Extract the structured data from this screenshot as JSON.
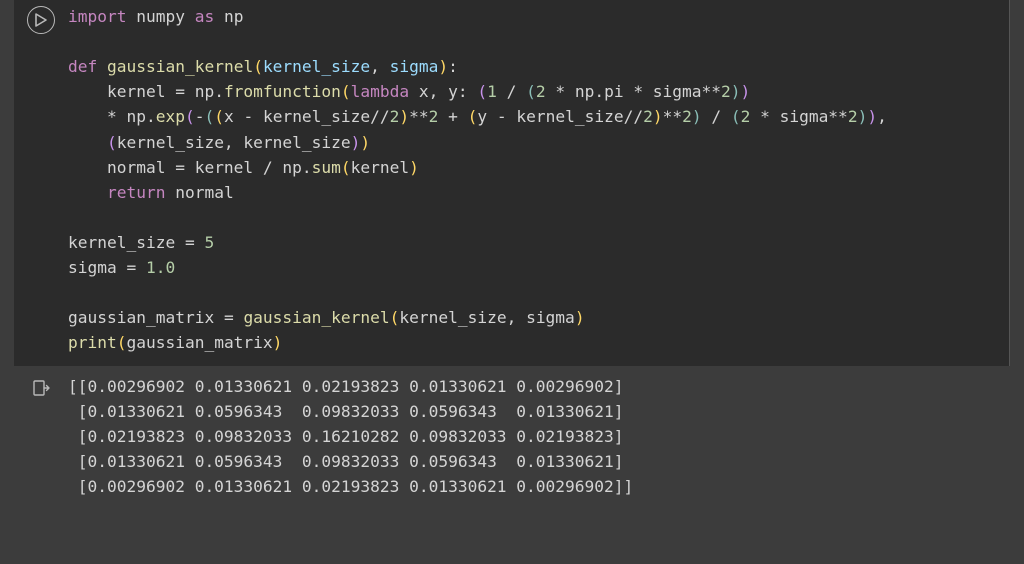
{
  "code": {
    "lines": [
      {
        "tokens": [
          {
            "t": "import",
            "c": "tk-kw"
          },
          {
            "t": " ",
            "c": ""
          },
          {
            "t": "numpy",
            "c": "tk-var"
          },
          {
            "t": " ",
            "c": ""
          },
          {
            "t": "as",
            "c": "tk-kw"
          },
          {
            "t": " ",
            "c": ""
          },
          {
            "t": "np",
            "c": "tk-var"
          }
        ]
      },
      {
        "tokens": []
      },
      {
        "tokens": [
          {
            "t": "def",
            "c": "tk-kw"
          },
          {
            "t": " ",
            "c": ""
          },
          {
            "t": "gaussian_kernel",
            "c": "tk-func"
          },
          {
            "t": "(",
            "c": "tk-paren"
          },
          {
            "t": "kernel_size",
            "c": "tk-param"
          },
          {
            "t": ", ",
            "c": ""
          },
          {
            "t": "sigma",
            "c": "tk-param"
          },
          {
            "t": ")",
            "c": "tk-paren"
          },
          {
            "t": ":",
            "c": ""
          }
        ]
      },
      {
        "tokens": [
          {
            "t": "    kernel ",
            "c": ""
          },
          {
            "t": "=",
            "c": "tk-op"
          },
          {
            "t": " np.",
            "c": ""
          },
          {
            "t": "fromfunction",
            "c": "tk-call"
          },
          {
            "t": "(",
            "c": "tk-paren"
          },
          {
            "t": "lambda",
            "c": "tk-kw"
          },
          {
            "t": " x, y: ",
            "c": ""
          },
          {
            "t": "(",
            "c": "tk-paren2"
          },
          {
            "t": "1",
            "c": "tk-num"
          },
          {
            "t": " / ",
            "c": ""
          },
          {
            "t": "(",
            "c": "tk-paren3"
          },
          {
            "t": "2",
            "c": "tk-num"
          },
          {
            "t": " * np.pi * sigma**",
            "c": ""
          },
          {
            "t": "2",
            "c": "tk-num"
          },
          {
            "t": ")",
            "c": "tk-paren3"
          },
          {
            "t": ")",
            "c": "tk-paren2"
          }
        ]
      },
      {
        "tokens": [
          {
            "t": "    * np.",
            "c": ""
          },
          {
            "t": "exp",
            "c": "tk-call"
          },
          {
            "t": "(",
            "c": "tk-paren2"
          },
          {
            "t": "-",
            "c": ""
          },
          {
            "t": "(",
            "c": "tk-paren3"
          },
          {
            "t": "(",
            "c": "tk-paren"
          },
          {
            "t": "x - kernel_size//",
            "c": ""
          },
          {
            "t": "2",
            "c": "tk-num"
          },
          {
            "t": ")",
            "c": "tk-paren"
          },
          {
            "t": "**",
            "c": ""
          },
          {
            "t": "2",
            "c": "tk-num"
          },
          {
            "t": " + ",
            "c": ""
          },
          {
            "t": "(",
            "c": "tk-paren"
          },
          {
            "t": "y - kernel_size//",
            "c": ""
          },
          {
            "t": "2",
            "c": "tk-num"
          },
          {
            "t": ")",
            "c": "tk-paren"
          },
          {
            "t": "**",
            "c": ""
          },
          {
            "t": "2",
            "c": "tk-num"
          },
          {
            "t": ")",
            "c": "tk-paren3"
          },
          {
            "t": " / ",
            "c": ""
          },
          {
            "t": "(",
            "c": "tk-paren3"
          },
          {
            "t": "2",
            "c": "tk-num"
          },
          {
            "t": " * sigma**",
            "c": ""
          },
          {
            "t": "2",
            "c": "tk-num"
          },
          {
            "t": ")",
            "c": "tk-paren3"
          },
          {
            "t": ")",
            "c": "tk-paren2"
          },
          {
            "t": ",",
            "c": ""
          }
        ]
      },
      {
        "tokens": [
          {
            "t": "    ",
            "c": ""
          },
          {
            "t": "(",
            "c": "tk-paren2"
          },
          {
            "t": "kernel_size, kernel_size",
            "c": ""
          },
          {
            "t": ")",
            "c": "tk-paren2"
          },
          {
            "t": ")",
            "c": "tk-paren"
          }
        ]
      },
      {
        "tokens": [
          {
            "t": "    normal ",
            "c": ""
          },
          {
            "t": "=",
            "c": "tk-op"
          },
          {
            "t": " kernel / np.",
            "c": ""
          },
          {
            "t": "sum",
            "c": "tk-call"
          },
          {
            "t": "(",
            "c": "tk-paren"
          },
          {
            "t": "kernel",
            "c": ""
          },
          {
            "t": ")",
            "c": "tk-paren"
          }
        ]
      },
      {
        "tokens": [
          {
            "t": "    ",
            "c": ""
          },
          {
            "t": "return",
            "c": "tk-kw"
          },
          {
            "t": " normal",
            "c": ""
          }
        ]
      },
      {
        "tokens": []
      },
      {
        "tokens": [
          {
            "t": "kernel_size ",
            "c": ""
          },
          {
            "t": "=",
            "c": "tk-op"
          },
          {
            "t": " ",
            "c": ""
          },
          {
            "t": "5",
            "c": "tk-num"
          }
        ]
      },
      {
        "tokens": [
          {
            "t": "sigma ",
            "c": ""
          },
          {
            "t": "=",
            "c": "tk-op"
          },
          {
            "t": " ",
            "c": ""
          },
          {
            "t": "1.0",
            "c": "tk-num"
          }
        ]
      },
      {
        "tokens": []
      },
      {
        "tokens": [
          {
            "t": "gaussian_matrix ",
            "c": ""
          },
          {
            "t": "=",
            "c": "tk-op"
          },
          {
            "t": " ",
            "c": ""
          },
          {
            "t": "gaussian_kernel",
            "c": "tk-call"
          },
          {
            "t": "(",
            "c": "tk-paren"
          },
          {
            "t": "kernel_size, sigma",
            "c": ""
          },
          {
            "t": ")",
            "c": "tk-paren"
          }
        ]
      },
      {
        "tokens": [
          {
            "t": "print",
            "c": "tk-builtin"
          },
          {
            "t": "(",
            "c": "tk-paren"
          },
          {
            "t": "gaussian_matrix",
            "c": ""
          },
          {
            "t": ")",
            "c": "tk-paren"
          }
        ]
      }
    ]
  },
  "output": {
    "lines": [
      "[[0.00296902 0.01330621 0.02193823 0.01330621 0.00296902]",
      " [0.01330621 0.0596343  0.09832033 0.0596343  0.01330621]",
      " [0.02193823 0.09832033 0.16210282 0.09832033 0.02193823]",
      " [0.01330621 0.0596343  0.09832033 0.0596343  0.01330621]",
      " [0.00296902 0.01330621 0.02193823 0.01330621 0.00296902]]"
    ]
  }
}
